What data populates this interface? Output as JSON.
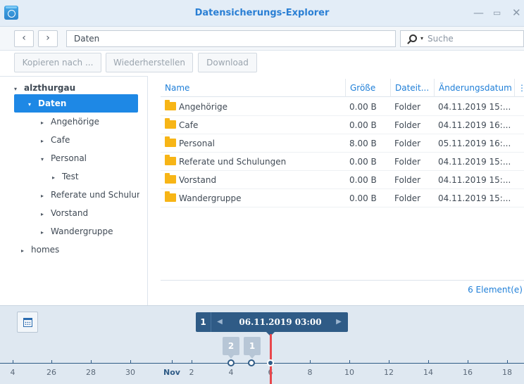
{
  "window": {
    "title": "Datensicherungs-Explorer",
    "controls": {
      "minimize": "—",
      "maximize": "▭",
      "close": "✕"
    }
  },
  "nav": {
    "back": "‹",
    "forward": "›",
    "path": "Daten",
    "search_placeholder": "Suche",
    "search_caret": "▾"
  },
  "toolbar": {
    "copy_label": "Kopieren nach ...",
    "restore_label": "Wiederherstellen",
    "download_label": "Download"
  },
  "tree": {
    "items": [
      {
        "label": "alzthurgau",
        "arrow": "▾"
      },
      {
        "label": "Daten",
        "arrow": "▾"
      },
      {
        "label": "Angehörige",
        "arrow": "▸"
      },
      {
        "label": "Cafe",
        "arrow": "▸"
      },
      {
        "label": "Personal",
        "arrow": "▾"
      },
      {
        "label": "Test",
        "arrow": "▸"
      },
      {
        "label": "Referate und Schulungen",
        "arrow": "▸"
      },
      {
        "label": "Vorstand",
        "arrow": "▸"
      },
      {
        "label": "Wandergruppe",
        "arrow": "▸"
      },
      {
        "label": "homes",
        "arrow": "▸"
      }
    ]
  },
  "grid": {
    "columns": [
      "Name",
      "Größe",
      "Dateit...",
      "Änderungsdatum",
      "⋮"
    ],
    "rows": [
      {
        "name": "Angehörige",
        "size": "0.00 B",
        "type": "Folder",
        "modified": "04.11.2019 15:..."
      },
      {
        "name": "Cafe",
        "size": "0.00 B",
        "type": "Folder",
        "modified": "04.11.2019 16:..."
      },
      {
        "name": "Personal",
        "size": "8.00 B",
        "type": "Folder",
        "modified": "05.11.2019 16:..."
      },
      {
        "name": "Referate und Schulungen",
        "size": "0.00 B",
        "type": "Folder",
        "modified": "04.11.2019 15:..."
      },
      {
        "name": "Vorstand",
        "size": "0.00 B",
        "type": "Folder",
        "modified": "04.11.2019 15:..."
      },
      {
        "name": "Wandergruppe",
        "size": "0.00 B",
        "type": "Folder",
        "modified": "04.11.2019 15:..."
      }
    ],
    "footer_count": "6 Element(e)"
  },
  "timeline": {
    "selected_count": "1",
    "selected_date": "06.11.2019 03:00",
    "prev": "◀",
    "next": "▶",
    "badges": [
      "2",
      "1"
    ],
    "ticks": [
      "4",
      "26",
      "28",
      "30",
      "Nov",
      "2",
      "4",
      "6",
      "8",
      "10",
      "12",
      "14",
      "16",
      "18"
    ]
  }
}
